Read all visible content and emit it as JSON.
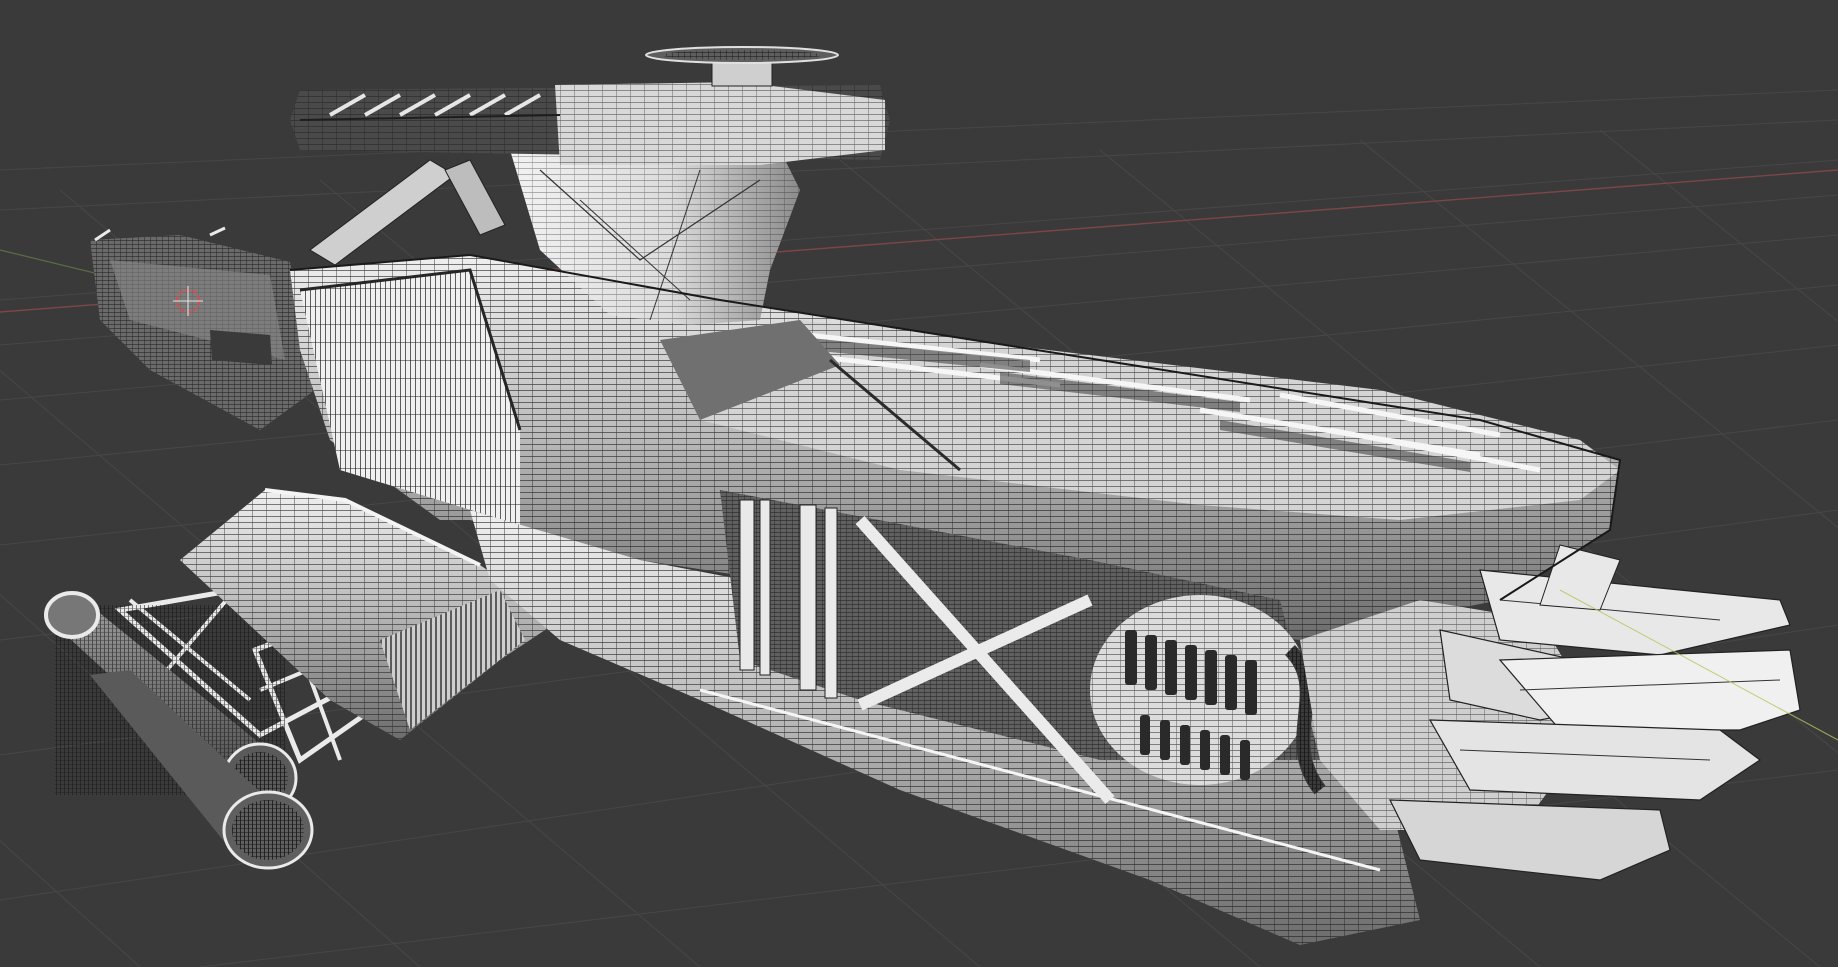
{
  "viewport": {
    "mode": "solid-wireframe-overlay",
    "background_color": "#3a3a3a",
    "grid_color": "#4a4a4a",
    "x_axis_color": "#8a4a4a",
    "y_axis_color": "#6a8a4a",
    "mesh_fill_color": "#d8d8d8",
    "wire_color": "#1f1f1f",
    "object": "spaceship-mesh",
    "origin_marker": "3d-cursor-icon"
  }
}
